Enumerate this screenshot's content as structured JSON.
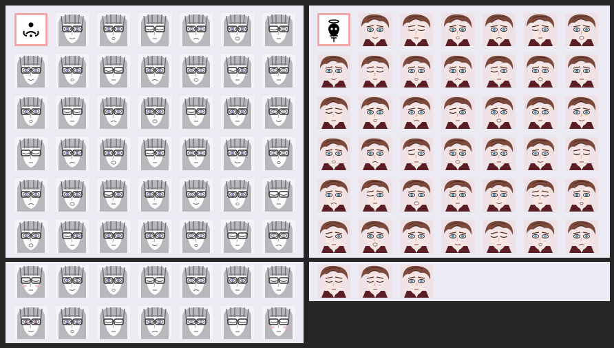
{
  "window": {
    "background": "#262626",
    "panel_color": "#ECEBF3",
    "selection_color": "#F0A8A8"
  },
  "palettes": [
    {
      "id": "glasses-face-set",
      "style": "glasses",
      "rows": 6,
      "cols": 7,
      "selected_tile": 0,
      "selected_icon": "avatar-swirl-icon",
      "eye_colors": [
        "#8E8BC0",
        "#8E8BC0",
        "#9A98C6",
        "#8E8BC0",
        "#A9A7CF",
        "#8E8BC0",
        "#B8B8C8"
      ],
      "expressions": [
        "neutral",
        "smile",
        "open",
        "closed",
        "frown",
        "surprised",
        "wink"
      ]
    },
    {
      "id": "brown-hair-face-set",
      "style": "brown",
      "rows": 6,
      "cols": 7,
      "selected_tile": 0,
      "selected_icon": "skull-candle-icon",
      "eye_colors": [
        "#5C8FB8",
        "#4F8FA8",
        "#6A9CC0",
        "#4F8FA8",
        "#5C8FB8",
        "#6A9CC0",
        "#4F8FA8"
      ],
      "expressions": [
        "neutral",
        "smile",
        "closed",
        "open",
        "frown",
        "wink",
        "surprised"
      ]
    },
    {
      "id": "glasses-face-set-extra",
      "style": "glasses",
      "rows": 2,
      "cols": 7,
      "selected_tile": -1,
      "eye_colors": [
        "#9A6F8E",
        "#8E8BC0",
        "#7C78B8",
        "#8E8BC0",
        "#A9A7CF",
        "#8E8BC0",
        "#C09AB0"
      ],
      "expressions": [
        "blush",
        "smile",
        "open",
        "closed",
        "frown",
        "neutral",
        "closed"
      ]
    },
    {
      "id": "brown-hair-face-set-extra",
      "style": "brown",
      "rows": 1,
      "cols": 3,
      "selected_tile": -1,
      "eye_colors": [
        "#5C8FB8",
        "#4F8FA8",
        "#6A9CC0"
      ],
      "expressions": [
        "closed",
        "closed",
        "neutral"
      ]
    }
  ]
}
